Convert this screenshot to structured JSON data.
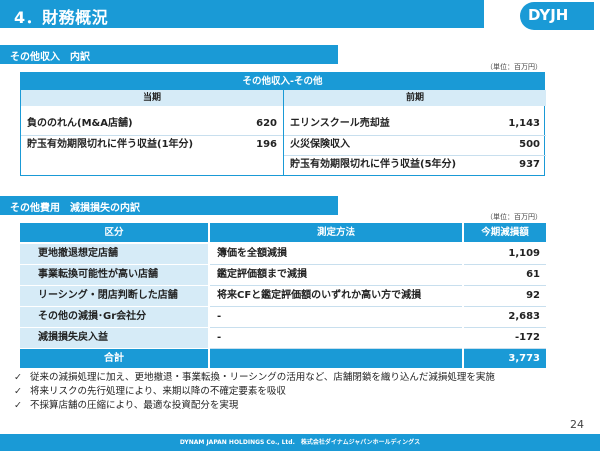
{
  "header": {
    "title": "4．財務概況",
    "logo": "DYJH"
  },
  "section1": {
    "heading": "その他収入　内訳",
    "unit": "（単位：百万円）",
    "caption": "その他収入-その他",
    "col_left": "当期",
    "col_right": "前期",
    "left_rows": [
      {
        "label": "負ののれん(M&A店舗)",
        "value": "620"
      },
      {
        "label": "貯玉有効期限切れに伴う収益(1年分)",
        "value": "196"
      }
    ],
    "right_rows": [
      {
        "label": "エリンスクール売却益",
        "value": "1,143"
      },
      {
        "label": "火災保険収入",
        "value": "500"
      },
      {
        "label": "貯玉有効期限切れに伴う収益(5年分)",
        "value": "937"
      }
    ]
  },
  "section2": {
    "heading": "その他費用　減損損失の内訳",
    "unit": "（単位：百万円）",
    "headers": [
      "区分",
      "測定方法",
      "今期減損額"
    ],
    "rows": [
      {
        "category": "更地撤退想定店舗",
        "method": "簿価を全額減損",
        "amount": "1,109"
      },
      {
        "category": "事業転換可能性が高い店舗",
        "method": "鑑定評価額まで減損",
        "amount": "61"
      },
      {
        "category": "リーシング・閉店判断した店舗",
        "method": "将来CFと鑑定評価額のいずれか高い方で減損",
        "amount": "92"
      },
      {
        "category": "その他の減損･Gr会社分",
        "method": "-",
        "amount": "2,683"
      },
      {
        "category": "減損損失戻入益",
        "method": "-",
        "amount": "-172"
      }
    ],
    "total_label": "合計",
    "total_value": "3,773"
  },
  "bullets": [
    "従来の減損処理に加え、更地撤退・事業転換・リーシングの活用など、店舗閉鎖を織り込んだ減損処理を実施",
    "将来リスクの先行処理により、来期以降の不確定要素を吸収",
    "不採算店舗の圧縮により、最適な投資配分を実現"
  ],
  "page_number": "24",
  "footer": "DYNAM JAPAN HOLDINGS Co., Ltd.　株式会社ダイナムジャパンホールディングス",
  "colors": {
    "accent": "#1a9ad6",
    "light": "#d6ebf7"
  }
}
